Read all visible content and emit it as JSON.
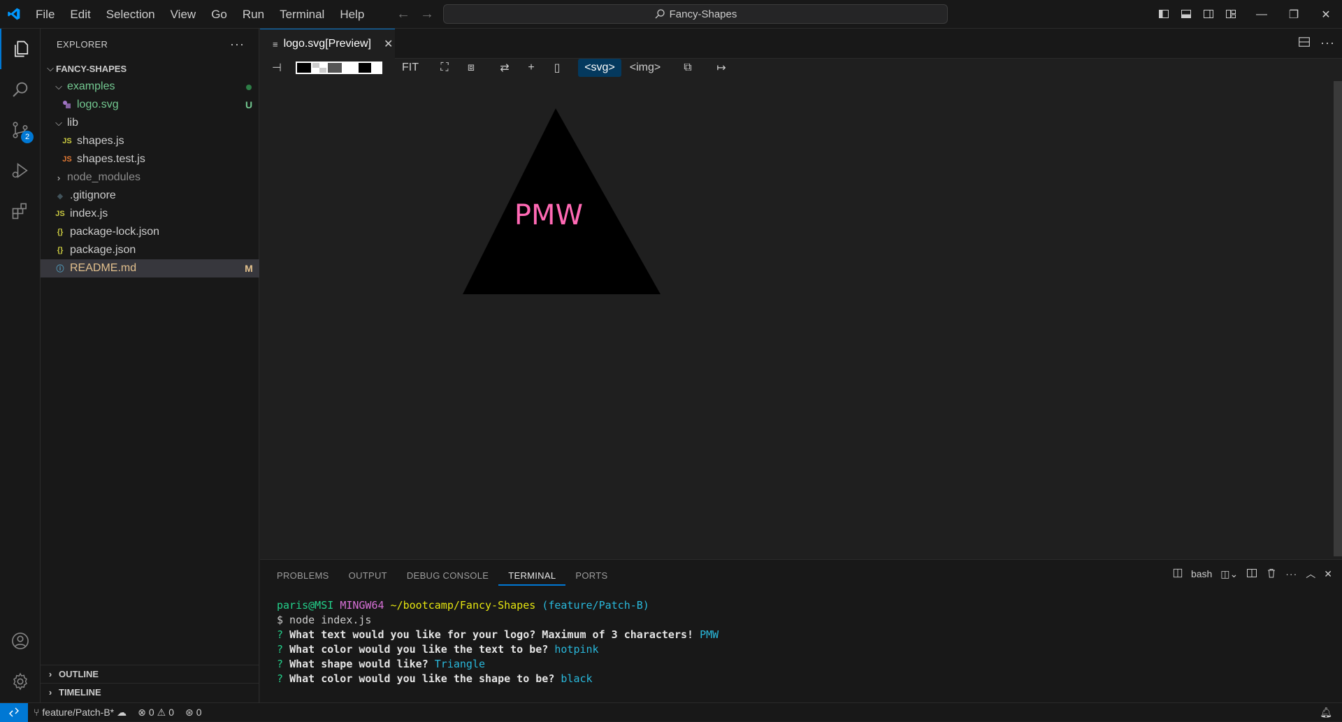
{
  "titlebar": {
    "menu": [
      "File",
      "Edit",
      "Selection",
      "View",
      "Go",
      "Run",
      "Terminal",
      "Help"
    ],
    "search_text": "Fancy-Shapes"
  },
  "sidebar": {
    "title": "EXPLORER",
    "folder_name": "FANCY-SHAPES",
    "items": [
      {
        "label": "examples",
        "icon": "chevron-down",
        "color": "#73c991",
        "deco": "dot"
      },
      {
        "label": "logo.svg",
        "icon": "svg-file",
        "color": "#73c991",
        "deco": "U"
      },
      {
        "label": "lib",
        "icon": "chevron-down",
        "color": "#cccccc",
        "deco": ""
      },
      {
        "label": "shapes.js",
        "icon": "js-file",
        "color": "#cccccc",
        "deco": ""
      },
      {
        "label": "shapes.test.js",
        "icon": "js-test-file",
        "color": "#cccccc",
        "deco": ""
      },
      {
        "label": "node_modules",
        "icon": "chevron-right",
        "color": "#8c8c8c",
        "deco": ""
      },
      {
        "label": ".gitignore",
        "icon": "git-file",
        "color": "#cccccc",
        "deco": ""
      },
      {
        "label": "index.js",
        "icon": "js-file",
        "color": "#cccccc",
        "deco": ""
      },
      {
        "label": "package-lock.json",
        "icon": "json-file",
        "color": "#cccccc",
        "deco": ""
      },
      {
        "label": "package.json",
        "icon": "json-file",
        "color": "#cccccc",
        "deco": ""
      },
      {
        "label": "README.md",
        "icon": "info-file",
        "color": "#e2c08d",
        "deco": "M"
      }
    ],
    "outline_label": "OUTLINE",
    "timeline_label": "TIMELINE"
  },
  "activitybar": {
    "source_control_badge": "2"
  },
  "editor": {
    "tab_label": "logo.svg[Preview]",
    "toolbar": {
      "fit_label": "FIT",
      "svg_label": "<svg>",
      "img_label": "<img>"
    },
    "preview": {
      "shape": "triangle",
      "shape_color": "black",
      "text": "PMW",
      "text_color": "hotpink"
    }
  },
  "panel": {
    "tabs": [
      "PROBLEMS",
      "OUTPUT",
      "DEBUG CONSOLE",
      "TERMINAL",
      "PORTS"
    ],
    "active_tab": "TERMINAL",
    "shell_label": "bash",
    "terminal": {
      "prompt_user": "paris@MSI",
      "prompt_host": "MINGW64",
      "prompt_path": "~/bootcamp/Fancy-Shapes",
      "prompt_branch": "(feature/Patch-B)",
      "command": "$ node index.js",
      "q1": "What text would you like for your logo? Maximum of 3 characters!",
      "a1": "PMW",
      "q2": "What color would you like the text to be?",
      "a2": "hotpink",
      "q3": "What shape would like?",
      "a3": "Triangle",
      "q4": "What color would you like the shape to be?",
      "a4": "black"
    }
  },
  "statusbar": {
    "branch": "feature/Patch-B*",
    "errors": "0",
    "warnings": "0",
    "ports": "0"
  }
}
